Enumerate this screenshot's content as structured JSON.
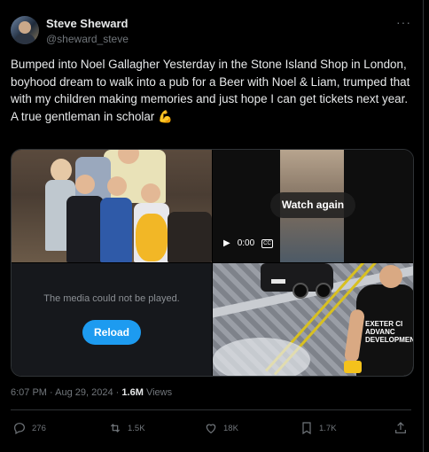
{
  "author": {
    "name": "Steve Sheward",
    "handle": "@sheward_steve"
  },
  "more_label": "···",
  "tweet_text": "Bumped into Noel Gallagher Yesterday in the Stone Island Shop in London, boyhood dream to walk into a pub for a Beer with Noel & Liam, trumped that with my children making memories and just hope I can get tickets next year.\nA true gentleman in scholar 💪",
  "media": {
    "watch_again_label": "Watch again",
    "video_time": "0:00",
    "cc_label": "CC",
    "error_message": "The media could not be played.",
    "reload_label": "Reload",
    "shirt_text": "EXETER CI\nADVANC\nDEVELOPMENT"
  },
  "meta": {
    "time": "6:07 PM",
    "separator": "·",
    "date": "Aug 29, 2024",
    "views_count": "1.6M",
    "views_label": "Views"
  },
  "actions": {
    "replies": "276",
    "reposts": "1.5K",
    "likes": "18K",
    "bookmarks": "1.7K"
  },
  "colors": {
    "background": "#000000",
    "text": "#e7e9ea",
    "muted": "#71767b",
    "accent": "#1d9bf0"
  }
}
